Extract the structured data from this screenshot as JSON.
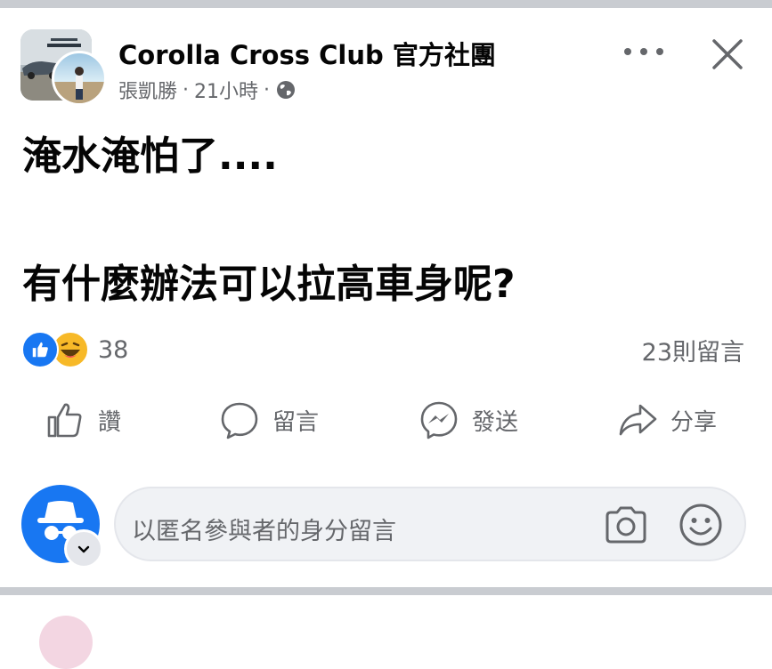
{
  "post": {
    "group_name": "Corolla Cross Club 官方社團",
    "author": "張凱勝",
    "time": "21小時",
    "separator": "·",
    "text_line1": "淹水淹怕了....",
    "text_line2": "有什麼辦法可以拉高車身呢?"
  },
  "icons": {
    "more": "more-horizontal-icon",
    "close": "close-icon",
    "privacy": "globe-icon",
    "like_reaction": "like-reaction-icon",
    "haha_reaction": "haha-reaction-icon"
  },
  "reactions": {
    "count": "38"
  },
  "comments": {
    "count_label": "23則留言"
  },
  "actions": {
    "like": "讚",
    "comment": "留言",
    "send": "發送",
    "share": "分享"
  },
  "comment_box": {
    "placeholder": "以匿名參與者的身分留言"
  },
  "colors": {
    "brand_blue": "#1877f2",
    "secondary_text": "#65676b",
    "input_bg": "#f0f2f5",
    "haha_yellow": "#f7b928",
    "separator": "#c9ccd1"
  }
}
